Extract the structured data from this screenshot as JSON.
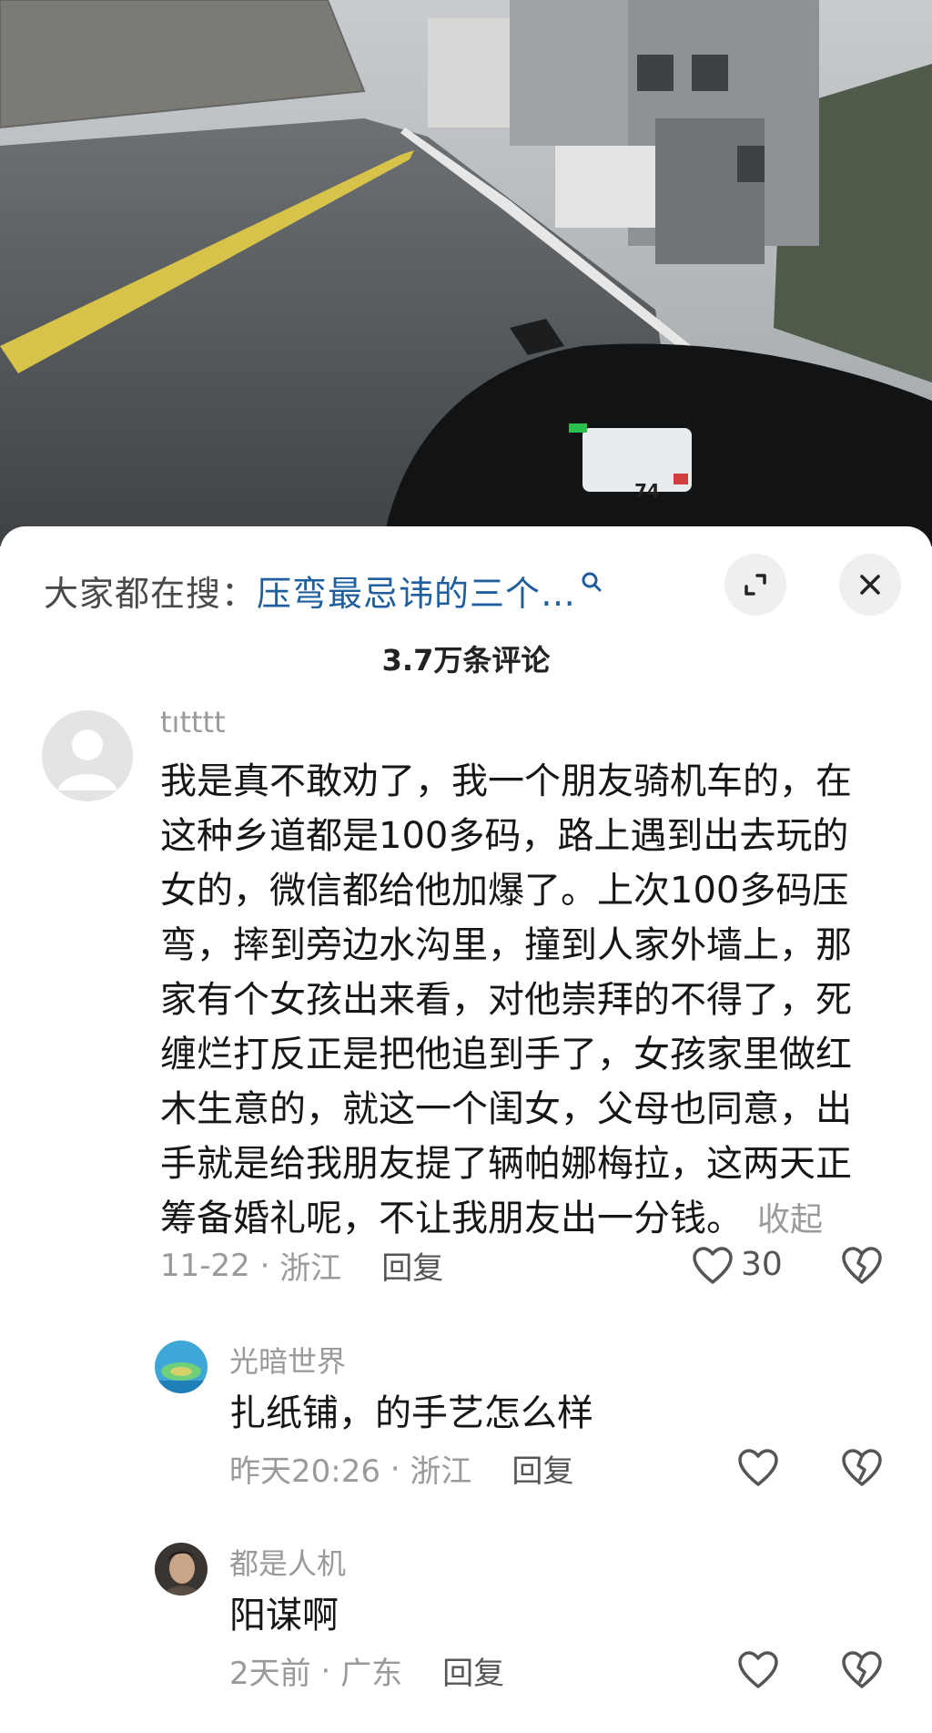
{
  "search": {
    "prefix": "大家都在搜：",
    "query": "压弯最忌讳的三个…"
  },
  "comment_count": "3.7万条评论",
  "video": {
    "speed_readout": "74"
  },
  "main_comment": {
    "username": "tıtttt",
    "text": "我是真不敢劝了，我一个朋友骑机车的，在这种乡道都是100多码，路上遇到出去玩的女的，微信都给他加爆了。上次100多码压弯，摔到旁边水沟里，撞到人家外墙上，那家有个女孩出来看，对他崇拜的不得了，死缠烂打反正是把他追到手了，女孩家里做红木生意的，就这一个闺女，父母也同意，出手就是给我朋友提了辆帕娜梅拉，这两天正筹备婚礼呢，不让我朋友出一分钱。",
    "lines": [
      "我是真不敢劝了，我一个朋友骑机车的，在",
      "这种乡道都是100多码，路上遇到出去玩的",
      "女的，微信都给他加爆了。上次100多码压",
      "弯，摔到旁边水沟里，撞到人家外墙上，那",
      "家有个女孩出来看，对他崇拜的不得了，死",
      "缠烂打反正是把他追到手了，女孩家里做红",
      "木生意的，就这一个闺女，父母也同意，出",
      "手就是给我朋友提了辆帕娜梅拉，这两天正",
      "筹备婚礼呢，不让我朋友出一分钱。"
    ],
    "collapse_label": "收起",
    "date": "11-22",
    "location": "浙江",
    "reply_label": "回复",
    "likes": "30"
  },
  "replies": [
    {
      "username": "光暗世界",
      "text": "扎纸铺，的手艺怎么样",
      "date": "昨天20:26",
      "location": "浙江",
      "reply_label": "回复"
    },
    {
      "username": "都是人机",
      "text": "阳谋啊",
      "date": "2天前",
      "location": "广东",
      "reply_label": "回复"
    }
  ],
  "icons": {
    "search": "search-icon",
    "expand": "expand-icon",
    "close": "close-icon",
    "like": "heart-icon",
    "dislike": "broken-heart-icon"
  },
  "colors": {
    "link": "#1f5f9e",
    "meta_text": "#9a9a9a",
    "body_text": "#161616"
  }
}
